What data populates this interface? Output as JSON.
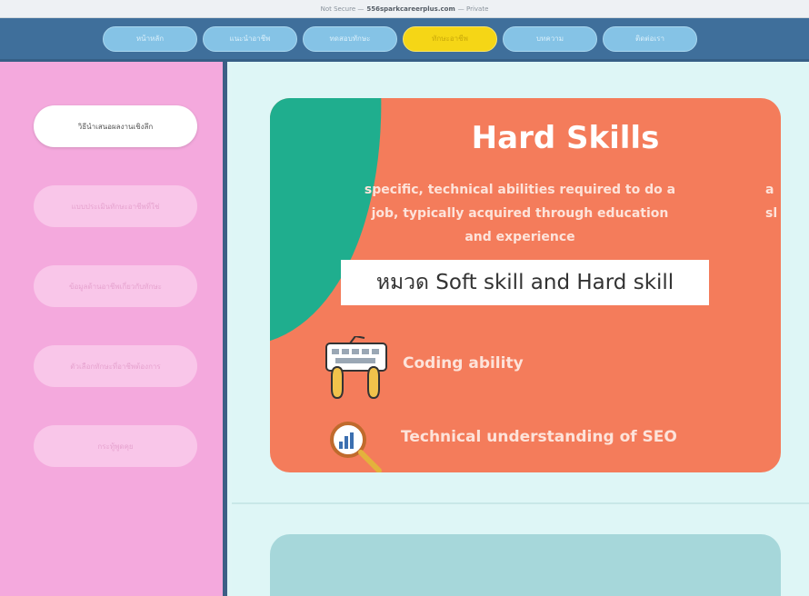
{
  "browser": {
    "url_prefix": "Not Secure —",
    "url_domain": "556sparkcareerplus.com",
    "url_suffix": "— Private"
  },
  "topnav": {
    "tabs": [
      {
        "label": "หน้าหลัก",
        "active": false
      },
      {
        "label": "แนะนำอาชีพ",
        "active": false
      },
      {
        "label": "ทดสอบทักษะ",
        "active": false
      },
      {
        "label": "ทักษะอาชีพ",
        "active": true
      },
      {
        "label": "บทความ",
        "active": false
      },
      {
        "label": "ติดต่อเรา",
        "active": false
      }
    ]
  },
  "sidebar": {
    "items": [
      {
        "label": "วิธีนำเสนอผลงานเชิงลึก",
        "active": true
      },
      {
        "label": "แบบประเมินทักษะอาชีพที่ใช่",
        "active": false
      },
      {
        "label": "ข้อมูลด้านอาชีพเกี่ยวกับทักษะ",
        "active": false
      },
      {
        "label": "ตัวเลือกทักษะที่อาชีพต้องการ",
        "active": false
      },
      {
        "label": "กระทู้พูดคุย",
        "active": false
      }
    ]
  },
  "card": {
    "title": "Hard Skills",
    "description": "specific, technical abilities required to do a job, typically acquired through education and experience",
    "edge_text_1": "a",
    "edge_text_2": "sl",
    "category_label": "หมวด Soft skill and Hard skill",
    "skills": [
      {
        "label": "Coding ability",
        "icon": "hands-keyboard-icon"
      },
      {
        "label": "Technical understanding of SEO",
        "icon": "magnifier-chart-icon"
      }
    ]
  },
  "colors": {
    "card_bg": "#f47c5b",
    "teal_accent": "#1fae8e",
    "sidebar_bg": "#f4a9dd",
    "nav_bg": "#3f6f9b",
    "active_tab": "#f5d616",
    "page_bg": "#def6f6"
  }
}
